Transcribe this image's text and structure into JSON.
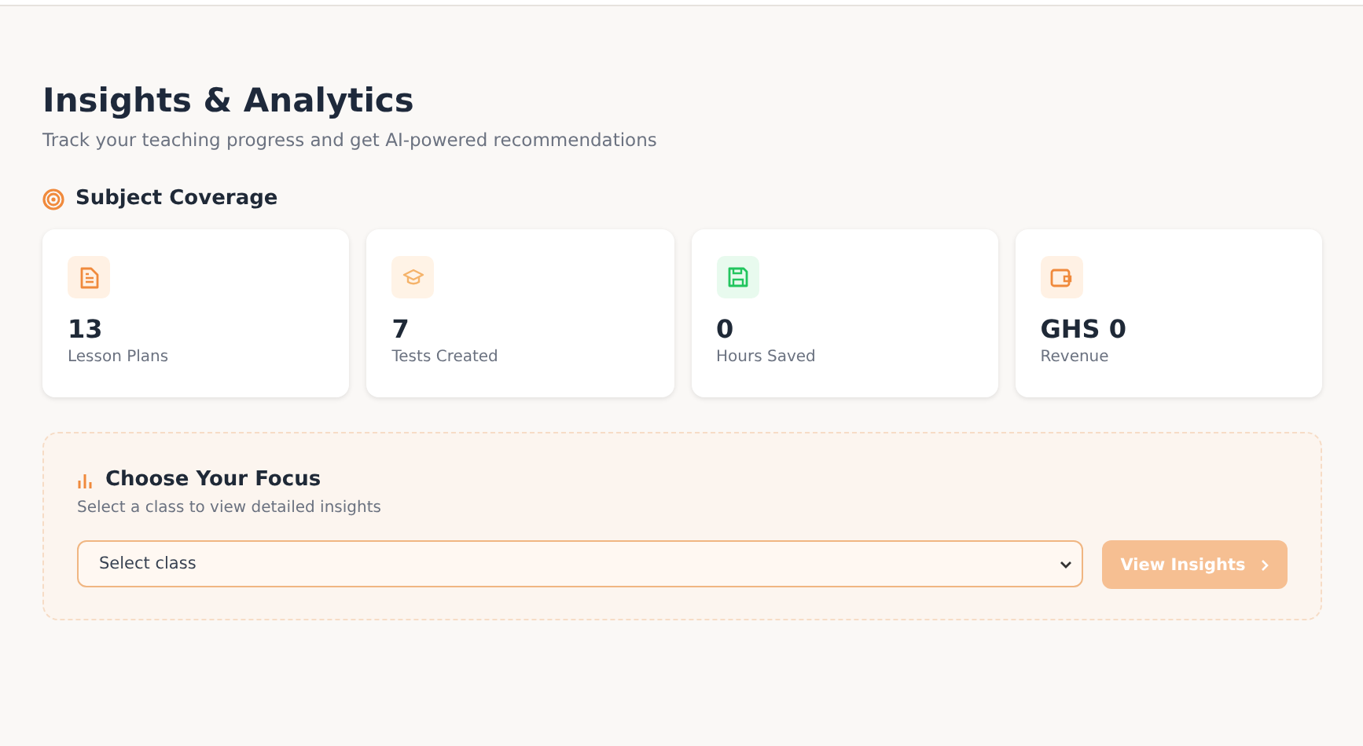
{
  "header": {
    "title": "Insights & Analytics",
    "subtitle": "Track your teaching progress and get AI-powered recommendations"
  },
  "section": {
    "title": "Subject Coverage"
  },
  "stats": [
    {
      "kind": "document",
      "value": "13",
      "label": "Lesson Plans"
    },
    {
      "kind": "graduation",
      "value": "7",
      "label": "Tests Created"
    },
    {
      "kind": "save",
      "value": "0",
      "label": "Hours Saved"
    },
    {
      "kind": "wallet",
      "value": "GHS 0",
      "label": "Revenue"
    }
  ],
  "focus": {
    "title": "Choose Your Focus",
    "subtitle": "Select a class to view detailed insights",
    "select": {
      "value": "Select class"
    },
    "button": {
      "label": "View Insights",
      "disabled": true
    }
  }
}
